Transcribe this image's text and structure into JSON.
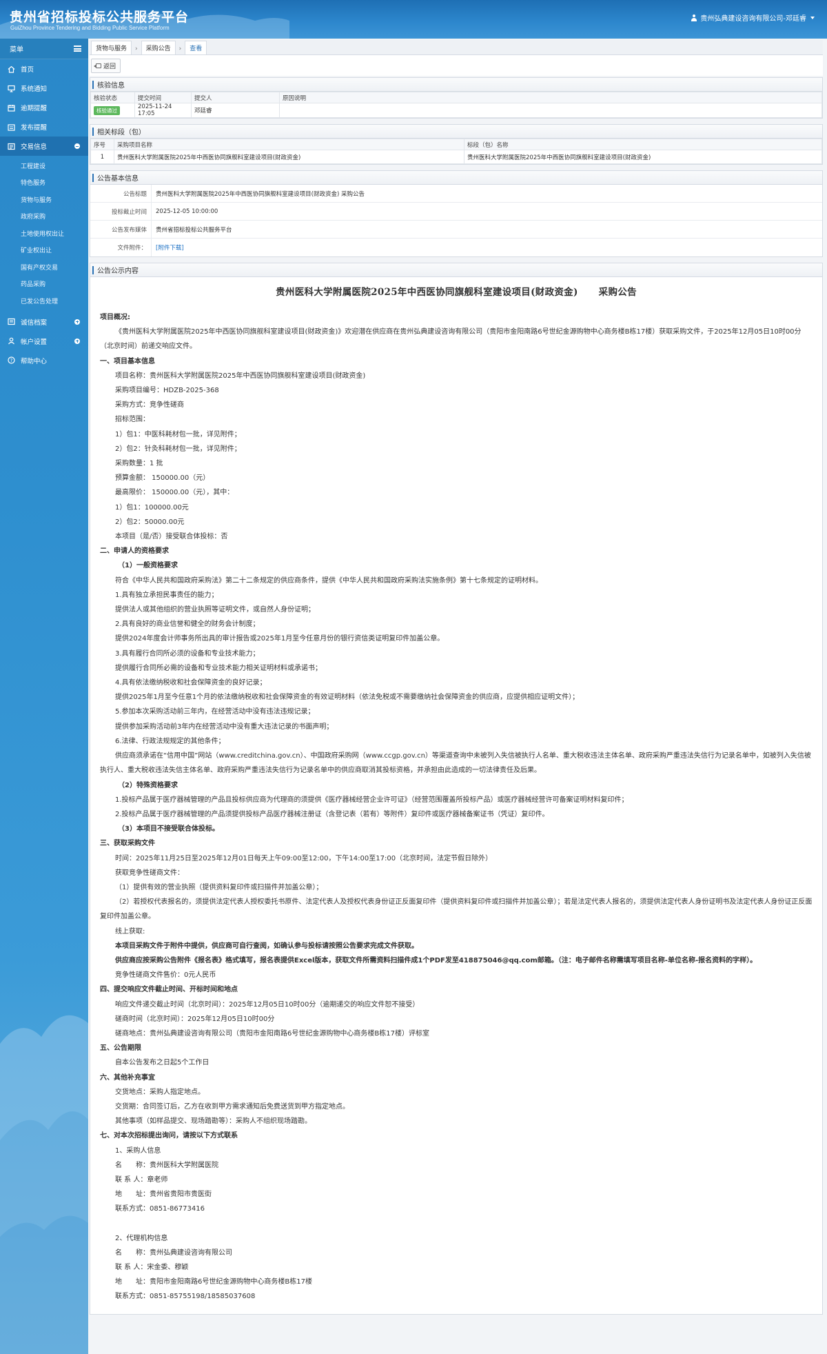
{
  "header": {
    "title": "贵州省招标投标公共服务平台",
    "subtitle": "GuiZhou Province Tendering and Bidding Public Service Platform",
    "user": "贵州弘典建设咨询有限公司-邓廷睿"
  },
  "sidebar": {
    "menu_label": "菜单",
    "items": [
      {
        "label": "首页",
        "icon": "home-icon"
      },
      {
        "label": "系统通知",
        "icon": "monitor-icon"
      },
      {
        "label": "逾期提醒",
        "icon": "alarm-icon"
      },
      {
        "label": "发布提醒",
        "icon": "publish-icon"
      },
      {
        "label": "交易信息",
        "icon": "trade-icon"
      }
    ],
    "sub_items": [
      "工程建设",
      "特色服务",
      "货物与服务",
      "政府采购",
      "土地使用权出让",
      "矿业权出让",
      "国有产权交易",
      "药品采购",
      "已发公告处理"
    ],
    "items_after": [
      {
        "label": "诚信档案",
        "icon": "credit-icon"
      },
      {
        "label": "帐户设置",
        "icon": "account-icon"
      },
      {
        "label": "帮助中心",
        "icon": "help-icon"
      }
    ]
  },
  "breadcrumb_tabs": [
    "货物与服务",
    "采购公告",
    "查看"
  ],
  "toolbar": {
    "back_label": "返回"
  },
  "verify": {
    "title": "核验信息",
    "headers": [
      "核验状态",
      "提交时间",
      "提交人",
      "原因说明"
    ],
    "status": "核验通过",
    "time": "2025-11-24 17:05",
    "submitter": "邓廷睿",
    "reason": ""
  },
  "sections_panel": {
    "title": "相关标段（包）",
    "headers": [
      "序号",
      "采购项目名称",
      "标段（包）名称"
    ],
    "rows": [
      {
        "no": "1",
        "project": "贵州医科大学附属医院2025年中西医协同旗舰科室建设项目(财政资金)",
        "section": "贵州医科大学附属医院2025年中西医协同旗舰科室建设项目(财政资金)"
      }
    ]
  },
  "basic": {
    "title": "公告基本信息",
    "rows": [
      {
        "k": "公告标题",
        "v": "贵州医科大学附属医院2025年中西医协同旗舰科室建设项目(财政资金) 采购公告"
      },
      {
        "k": "投标截止时间",
        "v": "2025-12-05 10:00:00"
      },
      {
        "k": "公告发布媒体",
        "v": "贵州省招标投标公共服务平台"
      },
      {
        "k": "文件附件：",
        "v": "[附件下载]"
      }
    ]
  },
  "notice": {
    "panel_title": "公告公示内容",
    "title_main": "贵州医科大学附属医院2025年中西医协同旗舰科室建设项目(财政资金)",
    "title_suffix": "采购公告",
    "lines": [
      {
        "t": "项目概况:",
        "c": "h"
      },
      {
        "t": "《贵州医科大学附属医院2025年中西医协同旗舰科室建设项目(财政资金)》欢迎潜在供应商在贵州弘典建设咨询有限公司（贵阳市金阳南路6号世纪金源购物中心商务楼B栋17楼）获取采购文件，于2025年12月05日10时00分（北京时间）前递交响应文件。",
        "c": "ind"
      },
      {
        "t": "一、项目基本信息",
        "c": "h"
      },
      {
        "t": "项目名称：贵州医科大学附属医院2025年中西医协同旗舰科室建设项目(财政资金)",
        "c": "i1"
      },
      {
        "t": "采购项目编号：HDZB-2025-368",
        "c": "i1"
      },
      {
        "t": "采购方式：竞争性磋商",
        "c": "i1"
      },
      {
        "t": "招标范围：",
        "c": "i1"
      },
      {
        "t": "1）包1：中医科耗材包一批，详见附件；",
        "c": "i1"
      },
      {
        "t": "2）包2：针灸科耗材包一批，详见附件；",
        "c": "i1"
      },
      {
        "t": "采购数量：1 批",
        "c": "i1"
      },
      {
        "t": "预算金额： 150000.00（元）",
        "c": "i1"
      },
      {
        "t": "最高限价： 150000.00（元），其中：",
        "c": "i1"
      },
      {
        "t": "1）包1：100000.00元",
        "c": "i1"
      },
      {
        "t": "2）包2：50000.00元",
        "c": "i1"
      },
      {
        "t": "本项目（是/否）接受联合体投标：否",
        "c": "i1"
      },
      {
        "t": "二、申请人的资格要求",
        "c": "h"
      },
      {
        "t": "（1）一般资格要求",
        "c": "h i2"
      },
      {
        "t": "符合《中华人民共和国政府采购法》第二十二条规定的供应商条件，提供《中华人民共和国政府采购法实施条例》第十七条规定的证明材料。",
        "c": "i1"
      },
      {
        "t": "1.具有独立承担民事责任的能力；",
        "c": "i1"
      },
      {
        "t": "提供法人或其他组织的营业执照等证明文件，或自然人身份证明；",
        "c": "i1"
      },
      {
        "t": "2.具有良好的商业信誉和健全的财务会计制度；",
        "c": "i1"
      },
      {
        "t": "提供2024年度会计师事务所出具的审计报告或2025年1月至今任意月份的银行资信类证明复印件加盖公章。",
        "c": "i1"
      },
      {
        "t": "3.具有履行合同所必须的设备和专业技术能力；",
        "c": "i1"
      },
      {
        "t": "提供履行合同所必需的设备和专业技术能力相关证明材料或承诺书；",
        "c": "i1"
      },
      {
        "t": "4.具有依法缴纳税收和社会保障资金的良好记录；",
        "c": "i1"
      },
      {
        "t": "提供2025年1月至今任意1个月的依法缴纳税收和社会保障资金的有效证明材料（依法免税或不需要缴纳社会保障资金的供应商，应提供相应证明文件）；",
        "c": "i1"
      },
      {
        "t": "5.参加本次采购活动前三年内，在经营活动中没有违法违规记录；",
        "c": "i1"
      },
      {
        "t": "提供参加采购活动前3年内在经营活动中没有重大违法记录的书面声明；",
        "c": "i1"
      },
      {
        "t": "6.法律、行政法规规定的其他条件；",
        "c": "i1"
      },
      {
        "t": "供应商须承诺在“信用中国”网站（www.creditchina.gov.cn）、中国政府采购网（www.ccgp.gov.cn）等渠道查询中未被列入失信被执行人名单、重大税收违法主体名单、政府采购严重违法失信行为记录名单中，如被列入失信被执行人、重大税收违法失信主体名单、政府采购严重违法失信行为记录名单中的供应商取消其投标资格，并承担由此造成的一切法律责任及后果。",
        "c": "ind"
      },
      {
        "t": "（2）特殊资格要求",
        "c": "h i2"
      },
      {
        "t": "1.投标产品属于医疗器械管理的产品且投标供应商为代理商的须提供《医疗器械经营企业许可证》（经营范围覆盖所投标产品）或医疗器械经营许可备案证明材料复印件；",
        "c": "i1"
      },
      {
        "t": "2.投标产品属于医疗器械管理的产品须提供投标产品医疗器械注册证（含登记表（若有）等附件）复印件或医疗器械备案证书（凭证）复印件。",
        "c": "i1"
      },
      {
        "t": "（3）本项目不接受联合体投标。",
        "c": "h i2"
      },
      {
        "t": "三、获取采购文件",
        "c": "h"
      },
      {
        "t": "时间：2025年11月25日至2025年12月01日每天上午09:00至12:00，下午14:00至17:00（北京时间，法定节假日除外）",
        "c": "i1"
      },
      {
        "t": "获取竞争性磋商文件：",
        "c": "i1"
      },
      {
        "t": "（1）提供有效的营业执照（提供资料复印件或扫描件并加盖公章）；",
        "c": "i1"
      },
      {
        "t": "（2）若授权代表报名的，须提供法定代表人授权委托书原件、法定代表人及授权代表身份证正反面复印件（提供资料复印件或扫描件并加盖公章）；若是法定代表人报名的，须提供法定代表人身份证明书及法定代表人身份证正反面复印件加盖公章。",
        "c": "ind"
      },
      {
        "t": "线上获取:",
        "c": "i1"
      },
      {
        "t": "本项目采购文件于附件中提供，供应商可自行查阅，如确认参与投标请按照公告要求完成文件获取。",
        "c": "h i1"
      },
      {
        "t": "供应商应按采购公告附件《报名表》格式填写，报名表提供Excel版本，获取文件所需资料扫描件成1个PDF发至418875046@qq.com邮箱。（注：电子邮件名称需填写项目名称-单位名称-报名资料的字样）。",
        "c": "h ind"
      },
      {
        "t": "竞争性磋商文件售价：0元人民币",
        "c": "i1"
      },
      {
        "t": "四、提交响应文件截止时间、开标时间和地点",
        "c": "h"
      },
      {
        "t": "响应文件递交截止时间（北京时间）：2025年12月05日10时00分（逾期递交的响应文件恕不接受）",
        "c": "i1"
      },
      {
        "t": "磋商时间（北京时间）：2025年12月05日10时00分",
        "c": "i1"
      },
      {
        "t": "磋商地点：贵州弘典建设咨询有限公司（贵阳市金阳南路6号世纪金源购物中心商务楼B栋17楼）评标室",
        "c": "i1"
      },
      {
        "t": "五、公告期限",
        "c": "h"
      },
      {
        "t": "自本公告发布之日起5个工作日",
        "c": "i1"
      },
      {
        "t": "六、其他补充事宜",
        "c": "h"
      },
      {
        "t": "交货地点：采购人指定地点。",
        "c": "i1"
      },
      {
        "t": "交货期：合同签订后，乙方在收到甲方需求通知后免费送货到甲方指定地点。",
        "c": "i1"
      },
      {
        "t": "其他事项（如样品提交、现场踏勘等）：采购人不组织现场踏勘。",
        "c": "i1"
      },
      {
        "t": "七、对本次招标提出询问，请按以下方式联系",
        "c": "h"
      },
      {
        "t": "1、采购人信息",
        "c": "i1"
      },
      {
        "t": "名　　称：贵州医科大学附属医院",
        "c": "i1"
      },
      {
        "t": "联 系 人：章老师",
        "c": "i1"
      },
      {
        "t": "地　　址：贵州省贵阳市贵医街",
        "c": "i1"
      },
      {
        "t": "联系方式：0851-86773416",
        "c": "i1"
      },
      {
        "t": "",
        "c": "blank"
      },
      {
        "t": "2、代理机构信息",
        "c": "i1"
      },
      {
        "t": "名　　称：贵州弘典建设咨询有限公司",
        "c": "i1"
      },
      {
        "t": "联 系 人：宋金委、穆颖",
        "c": "i1"
      },
      {
        "t": "地　　址：贵阳市金阳南路6号世纪金源购物中心商务楼B栋17楼",
        "c": "i1"
      },
      {
        "t": "联系方式：0851-85755198/18585037608",
        "c": "i1"
      }
    ]
  },
  "colors": {
    "header": "#2c86cc",
    "sidebar": "#2e8fcf",
    "accent": "#2a72b5",
    "badge": "#5cb85c"
  }
}
